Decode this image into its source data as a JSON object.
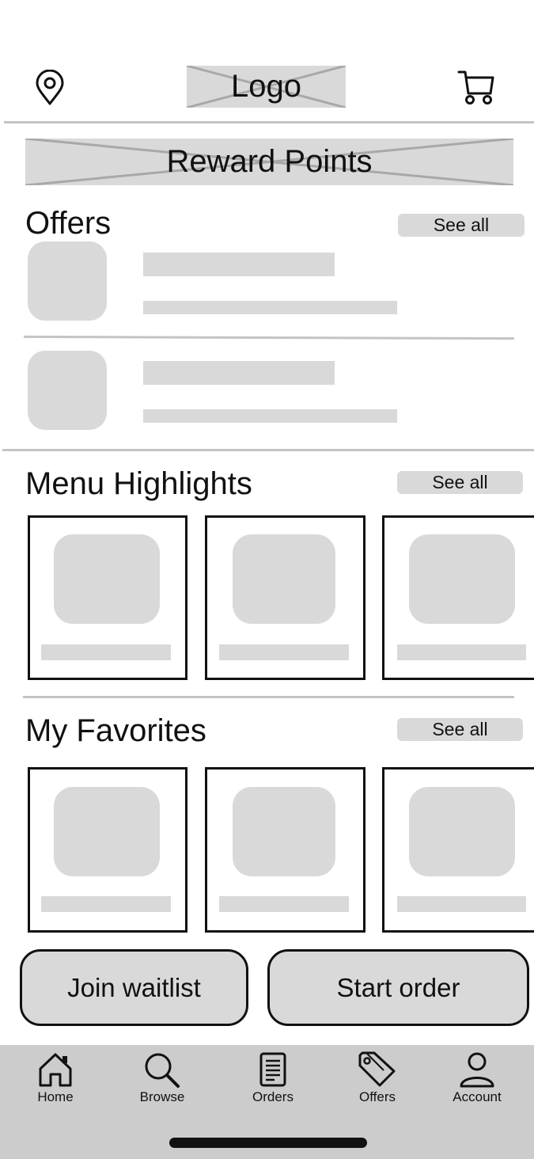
{
  "header": {
    "logo_text": "Logo",
    "location_icon": "location-pin-icon",
    "cart_icon": "shopping-cart-icon"
  },
  "reward": {
    "label": "Reward Points"
  },
  "offers": {
    "title": "Offers",
    "see_all": "See all"
  },
  "menu_highlights": {
    "title": "Menu Highlights",
    "see_all": "See all"
  },
  "favorites": {
    "title": "My Favorites",
    "see_all": "See all"
  },
  "actions": {
    "join_waitlist": "Join waitlist",
    "start_order": "Start order"
  },
  "tabbar": {
    "items": [
      {
        "label": "Home",
        "icon": "home-icon"
      },
      {
        "label": "Browse",
        "icon": "search-icon"
      },
      {
        "label": "Orders",
        "icon": "document-icon"
      },
      {
        "label": "Offers",
        "icon": "tag-icon"
      },
      {
        "label": "Account",
        "icon": "person-icon"
      }
    ]
  },
  "colors": {
    "placeholder": "#d9d9d9",
    "divider": "#c4c4c4",
    "tabbar_bg": "#cccccc",
    "stroke": "#111111"
  }
}
